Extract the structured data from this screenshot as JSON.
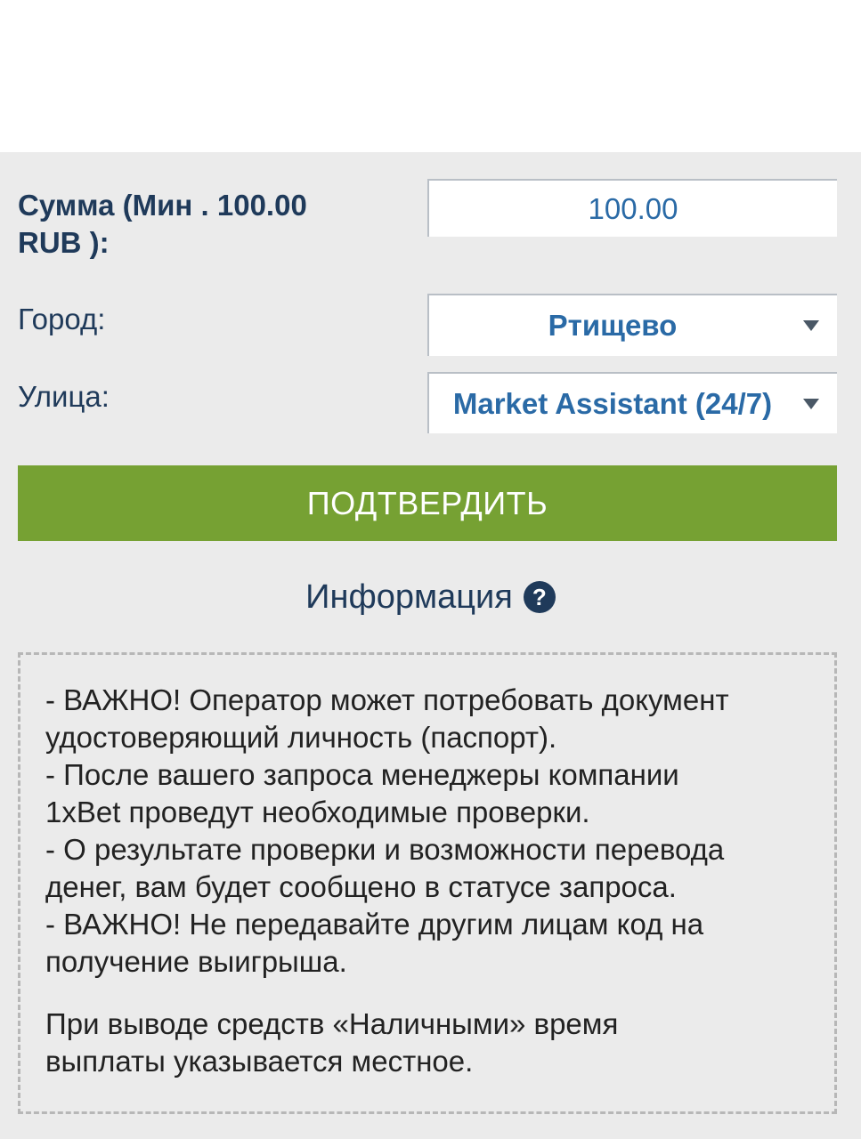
{
  "form": {
    "amount_label_line1": "Сумма (Мин . 100.00",
    "amount_label_line2": "RUB ):",
    "amount_value": "100.00",
    "city_label": "Город:",
    "city_value": "Ртищево",
    "street_label": "Улица:",
    "street_value": "Market Assistant (24/7)",
    "confirm_label": "ПОДТВЕРДИТЬ"
  },
  "info": {
    "heading": "Информация",
    "help_icon": "question-circle-icon",
    "lines": [
      "- ВАЖНО! Оператор может потребовать документ",
      "удостоверяющий личность (паспорт).",
      "- После вашего запроса менеджеры компании",
      "1xBet проведут необходимые проверки.",
      "- О результате проверки и возможности перевода",
      "денег, вам будет сообщено в статусе запроса.",
      "- ВАЖНО! Не передавайте другим лицам код на",
      "получение выигрыша."
    ],
    "note_lines": [
      "При выводе средств «Наличными» время",
      "выплаты указывается местное."
    ]
  },
  "colors": {
    "confirm_button": "#76a133",
    "label_text": "#1f3a5a",
    "field_text": "#2a6aa6"
  }
}
